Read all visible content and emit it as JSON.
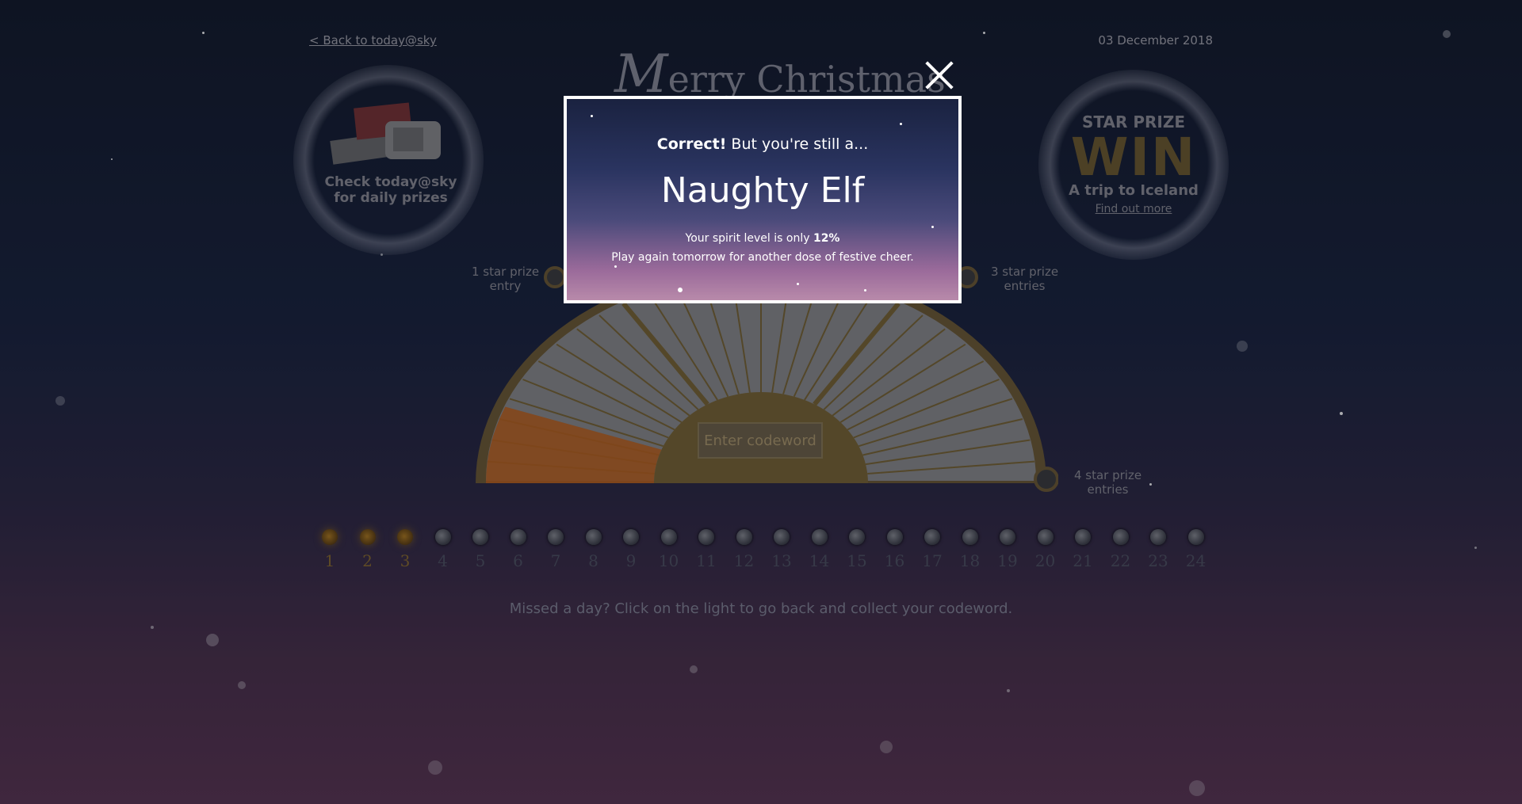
{
  "header": {
    "back_link": "< Back to today@sky",
    "date": "03 December 2018",
    "title_initial": "M",
    "title_rest": "erry Christmas"
  },
  "left_promo": {
    "line1": "Check today@sky",
    "line2": "for daily prizes"
  },
  "right_promo": {
    "label": "STAR PRIZE",
    "win": "WIN",
    "prize": "A trip to Iceland",
    "link": "Find out more"
  },
  "dial": {
    "labels": {
      "one_star_a": "1 star prize",
      "one_star_b": "entry",
      "three_star_a": "3 star prize",
      "three_star_b": "entries",
      "four_star_a": "4 star prize",
      "four_star_b": "entries"
    },
    "codeword_button": "Enter codeword",
    "fill_percent": 12
  },
  "calendar": {
    "days": [
      "1",
      "2",
      "3",
      "4",
      "5",
      "6",
      "7",
      "8",
      "9",
      "10",
      "11",
      "12",
      "13",
      "14",
      "15",
      "16",
      "17",
      "18",
      "19",
      "20",
      "21",
      "22",
      "23",
      "24"
    ],
    "lit_days": 3,
    "missed_text": "Missed a day? Click on the light to go back and collect your codeword."
  },
  "modal": {
    "correct_bold": "Correct!",
    "correct_rest": " But you're still a...",
    "title": "Naughty Elf",
    "spirit_prefix": "Your spirit level is only ",
    "spirit_value": "12%",
    "play_again": "Play again tomorrow for another dose of festive cheer."
  },
  "colors": {
    "gold": "#8a6a2a",
    "orange": "#d0721a",
    "modal_border": "#ffffff"
  }
}
